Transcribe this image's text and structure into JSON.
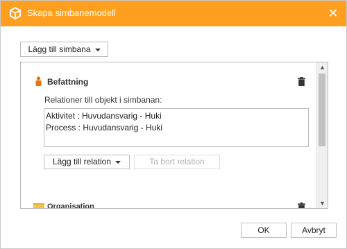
{
  "dialog": {
    "title": "Skapa simbanemodell",
    "close_label": "✕"
  },
  "toolbar": {
    "add_lane_label": "Lägg till simbana"
  },
  "lanes": [
    {
      "title": "Befattning",
      "relations_label": "Relationer till objekt i simbanan:",
      "relations": [
        "Aktivitet : Huvudansvarig - Huki",
        "Process : Huvudansvarig - Huki"
      ],
      "add_relation_label": "Lägg till relation",
      "remove_relation_label": "Ta bort relation"
    },
    {
      "title": "Organisation"
    }
  ],
  "footer": {
    "ok_label": "OK",
    "cancel_label": "Avbryt"
  },
  "colors": {
    "titlebar": "#ff9f1f",
    "lane_icon": "#e8730f",
    "folder_icon": "#f3c54a"
  }
}
